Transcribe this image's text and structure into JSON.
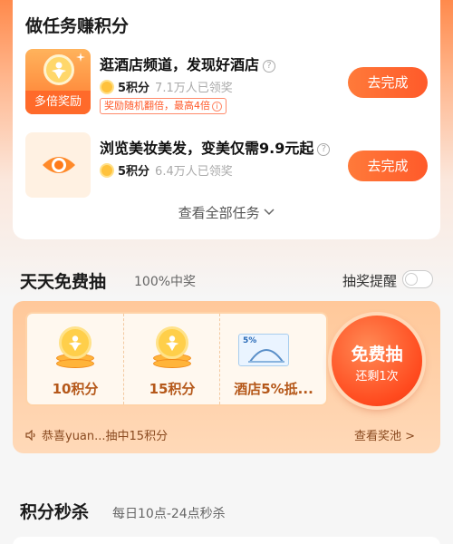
{
  "tasks": {
    "title": "做任务赚积分",
    "items": [
      {
        "title": "逛酒店频道，发现好酒店",
        "points": "5积分",
        "claimed": "7.1万人已领奖",
        "icon_badge": "多倍奖励",
        "reward_tag": "奖励随机翻倍，最高4倍",
        "button": "去完成",
        "icon": "coin-person-icon"
      },
      {
        "title": "浏览美妆美发，变美仅需9.9元起",
        "points": "5积分",
        "claimed": "6.4万人已领奖",
        "button": "去完成",
        "icon": "eye-icon"
      }
    ],
    "view_all": "查看全部任务"
  },
  "lottery": {
    "title": "天天免费抽",
    "subtitle": "100%中奖",
    "reminder_label": "抽奖提醒",
    "reminder_on": false,
    "prizes": [
      {
        "label": "10积分",
        "icon": "coin-stack-icon"
      },
      {
        "label": "15积分",
        "icon": "coin-stack-icon"
      },
      {
        "label": "酒店5%抵...",
        "icon": "hotel-coupon-icon",
        "coupon_text": "5%"
      }
    ],
    "draw_button": "免费抽",
    "remaining": "还剩1次",
    "winner_text": "恭喜yuan...抽中15积分",
    "pool_link": "查看奖池 >"
  },
  "seckill": {
    "title": "积分秒杀",
    "subtitle": "每日10点-24点秒杀"
  },
  "colors": {
    "accent": "#ff5a2a",
    "prize_text": "#b5581a"
  }
}
